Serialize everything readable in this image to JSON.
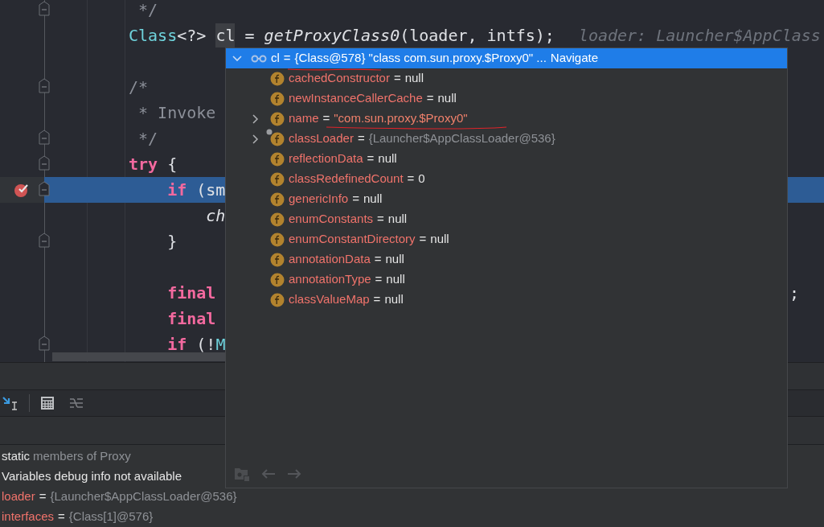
{
  "editor": {
    "lines": [
      {
        "fold": true,
        "highlighted": false,
        "breakpoint": false,
        "tokens": [
          {
            "kind": "comment",
            "text": " */"
          }
        ]
      },
      {
        "fold": false,
        "highlighted": false,
        "breakpoint": false,
        "tokens": [
          {
            "kind": "type",
            "text": "Class"
          },
          {
            "kind": "plain",
            "text": "<?> "
          },
          {
            "kind": "local",
            "text": "cl"
          },
          {
            "kind": "plain",
            "text": " = "
          },
          {
            "kind": "method",
            "text": "getProxyClass0"
          },
          {
            "kind": "plain",
            "text": "(loader, intfs);"
          }
        ],
        "hint": "loader: Launcher$AppClass"
      },
      {
        "fold": false,
        "highlighted": false,
        "breakpoint": false
      },
      {
        "fold": true,
        "highlighted": false,
        "breakpoint": false,
        "tokens": [
          {
            "kind": "comment",
            "text": "/*"
          }
        ]
      },
      {
        "fold": false,
        "highlighted": false,
        "breakpoint": false,
        "tokens": [
          {
            "kind": "comment",
            "text": " * Invoke"
          }
        ]
      },
      {
        "fold": true,
        "highlighted": false,
        "breakpoint": false,
        "tokens": [
          {
            "kind": "comment",
            "text": " */"
          }
        ]
      },
      {
        "fold": true,
        "highlighted": false,
        "breakpoint": false,
        "tokens": [
          {
            "kind": "keyword",
            "text": "try"
          },
          {
            "kind": "plain",
            "text": " {"
          }
        ]
      },
      {
        "fold": true,
        "highlighted": true,
        "breakpoint": true,
        "tokens": [
          {
            "kind": "keyword",
            "text": "    if"
          },
          {
            "kind": "plain",
            "text": " (sm"
          }
        ]
      },
      {
        "fold": false,
        "highlighted": false,
        "breakpoint": false,
        "tokens": [
          {
            "kind": "method",
            "text": "        ch"
          }
        ]
      },
      {
        "fold": true,
        "highlighted": false,
        "breakpoint": false,
        "tokens": [
          {
            "kind": "plain",
            "text": "    }"
          }
        ]
      },
      {
        "fold": false,
        "highlighted": false,
        "breakpoint": false
      },
      {
        "fold": false,
        "highlighted": false,
        "breakpoint": false,
        "tokens": [
          {
            "kind": "keyword",
            "text": "    final"
          }
        ],
        "tail": ";"
      },
      {
        "fold": false,
        "highlighted": false,
        "breakpoint": false,
        "tokens": [
          {
            "kind": "keyword",
            "text": "    final"
          }
        ]
      },
      {
        "fold": true,
        "highlighted": false,
        "breakpoint": false,
        "tokens": [
          {
            "kind": "keyword",
            "text": "    if"
          },
          {
            "kind": "plain",
            "text": " (!"
          },
          {
            "kind": "type",
            "text": "M"
          }
        ]
      }
    ]
  },
  "popup": {
    "header": {
      "expanded": true,
      "name": "cl",
      "eq": "=",
      "value": "{Class@578} \"class com.sun.proxy.$Proxy0\" ...",
      "link": "Navigate"
    },
    "fields": [
      {
        "name": "cachedConstructor",
        "eq": "=",
        "value": "null",
        "kind": "plain",
        "expandable": false,
        "pinned": false
      },
      {
        "name": "newInstanceCallerCache",
        "eq": "=",
        "value": "null",
        "kind": "plain",
        "expandable": false,
        "pinned": false
      },
      {
        "name": "name",
        "eq": "=",
        "value": "\"com.sun.proxy.$Proxy0\"",
        "kind": "string",
        "expandable": true,
        "pinned": false
      },
      {
        "name": "classLoader",
        "eq": "=",
        "value": "{Launcher$AppClassLoader@536}",
        "kind": "object",
        "expandable": true,
        "pinned": true
      },
      {
        "name": "reflectionData",
        "eq": "=",
        "value": "null",
        "kind": "plain",
        "expandable": false,
        "pinned": false
      },
      {
        "name": "classRedefinedCount",
        "eq": "=",
        "value": "0",
        "kind": "plain",
        "expandable": false,
        "pinned": false
      },
      {
        "name": "genericInfo",
        "eq": "=",
        "value": "null",
        "kind": "plain",
        "expandable": false,
        "pinned": false
      },
      {
        "name": "enumConstants",
        "eq": "=",
        "value": "null",
        "kind": "plain",
        "expandable": false,
        "pinned": false
      },
      {
        "name": "enumConstantDirectory",
        "eq": "=",
        "value": "null",
        "kind": "plain",
        "expandable": false,
        "pinned": false
      },
      {
        "name": "annotationData",
        "eq": "=",
        "value": "null",
        "kind": "plain",
        "expandable": false,
        "pinned": false
      },
      {
        "name": "annotationType",
        "eq": "=",
        "value": "null",
        "kind": "plain",
        "expandable": false,
        "pinned": false
      },
      {
        "name": "classValueMap",
        "eq": "=",
        "value": "null",
        "kind": "plain",
        "expandable": false,
        "pinned": false
      }
    ]
  },
  "variables": [
    {
      "kind": "static",
      "keyword": "static",
      "text": "members of Proxy"
    },
    {
      "kind": "message",
      "text": "Variables debug info not available"
    },
    {
      "kind": "var",
      "name": "loader",
      "eq": "=",
      "value": "{Launcher$AppClassLoader@536}"
    },
    {
      "kind": "var",
      "name": "interfaces",
      "eq": "=",
      "value": "{Class[1]@576}"
    }
  ]
}
